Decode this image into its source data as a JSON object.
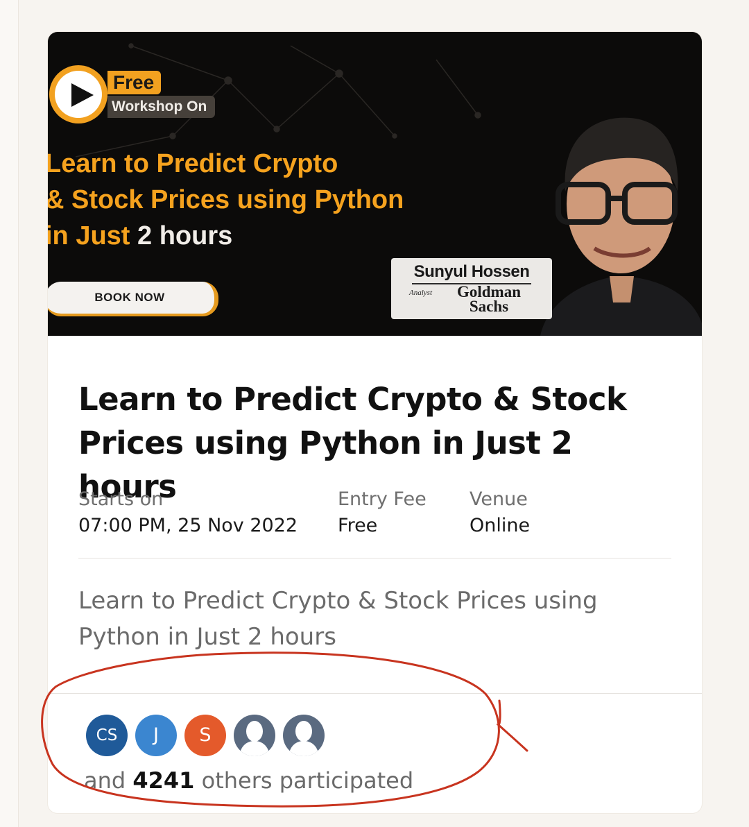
{
  "banner": {
    "badge_free": "Free",
    "badge_workshop": "Workshop On",
    "headline_line1": "Learn to Predict Crypto",
    "headline_line2": "& Stock Prices using Python",
    "headline_line3_orange": "in Just ",
    "headline_line3_white": "2 hours",
    "book_now": "BOOK NOW",
    "speaker_name": "Sunyul Hossen",
    "speaker_role": "Analyst",
    "speaker_company": "Goldman Sachs",
    "accent_color": "#f2a120"
  },
  "event": {
    "title": "Learn to Predict Crypto & Stock Prices using Python in Just 2 hours",
    "starts_label": "Starts on",
    "starts_value": "07:00 PM, 25 Nov 2022",
    "fee_label": "Entry Fee",
    "fee_value": "Free",
    "venue_label": "Venue",
    "venue_value": "Online",
    "description": "Learn to Predict Crypto & Stock Prices using Python in Just 2 hours"
  },
  "participants": {
    "avatars": [
      {
        "initials": "CS",
        "color": "#1f5a99"
      },
      {
        "initials": "J",
        "color": "#3b86d0"
      },
      {
        "initials": "S",
        "color": "#e45a2b"
      },
      {
        "initials": "",
        "icon": "person-silhouette-icon",
        "color": "#5a6a80"
      },
      {
        "initials": "",
        "icon": "person-silhouette-icon",
        "color": "#5a6a80"
      }
    ],
    "prefix": "and ",
    "count": "4241",
    "suffix": " others participated"
  },
  "annotation_color": "#c8341f"
}
